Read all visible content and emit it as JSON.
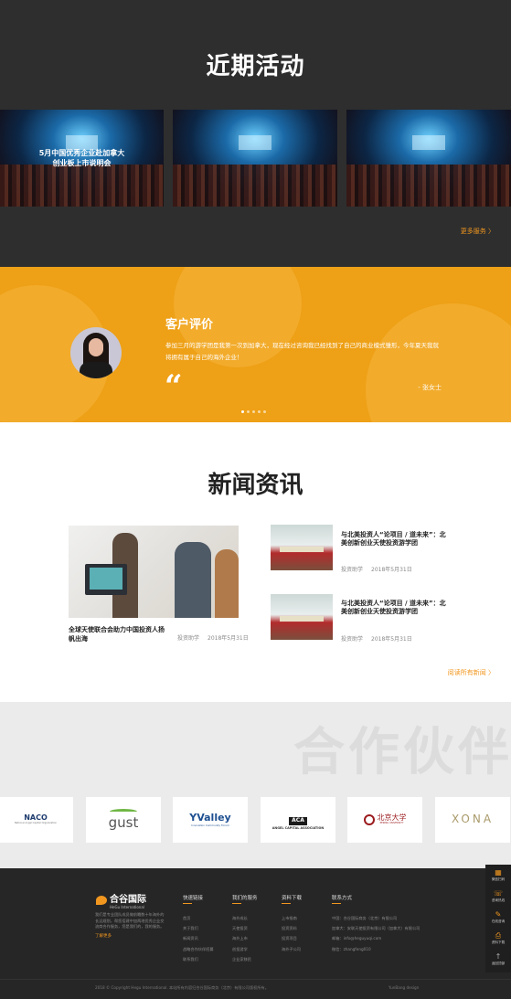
{
  "events": {
    "title": "近期活动",
    "cards": [
      {
        "caption_line1": "5月中国优秀企业赴加拿大",
        "caption_line2": "创业板上市说明会"
      },
      {
        "caption_line1": "",
        "caption_line2": ""
      },
      {
        "caption_line1": "",
        "caption_line2": ""
      }
    ],
    "more_label": "更多服务 〉"
  },
  "review": {
    "title": "客户评价",
    "text": "参加三月的游学团是我第一次到加拿大，现在经过咨询我已经找到了自己的商业模式雏形，今年夏天我就将拥有属于自己的海外企业！",
    "quote_mark": "“",
    "author": "- 张女士",
    "dots": 5,
    "active_dot": 0
  },
  "news": {
    "title": "新闻资讯",
    "main": {
      "title": "全球天使联合会助力中国投资人扬帆出海",
      "category": "投资助学",
      "date": "2018年5月31日"
    },
    "items": [
      {
        "title": "与北美投资人“论项目 / 道未来”：北美创新创业天使投资游学团",
        "category": "投资助学",
        "date": "2018年5月31日"
      },
      {
        "title": "与北美投资人“论项目 / 道未来”：北美创新创业天使投资游学团",
        "category": "投资助学",
        "date": "2018年5月31日"
      }
    ],
    "read_all_label": "阅读所有新闻 〉"
  },
  "partners": {
    "bg_title": "合作伙伴",
    "logos": [
      {
        "name": "NACO",
        "sub": "National Angel Capital Organization"
      },
      {
        "name": "gust",
        "sub": ""
      },
      {
        "name": "YValley",
        "sub": "Innovation Community Forum"
      },
      {
        "name": "ACA",
        "sub": "ANGEL CAPITAL ASSOCIATION"
      },
      {
        "name": "北京大学",
        "sub": "PEKING UNIVERSITY"
      },
      {
        "name": "XONA",
        "sub": ""
      }
    ]
  },
  "footer": {
    "logo_text": "合谷国际",
    "logo_sub": "HeGu International",
    "description": "我们是专业团队成员做前瞻数十年海外的长远规划，帮您搭建中加两地优秀企业交流商合作服务，您是我们的，我的服务。",
    "more_label": "了解更多",
    "columns": [
      {
        "title": "快速链接",
        "items": [
          "首页",
          "关于我们",
          "新闻资讯",
          "战略合作伙伴招募",
          "联系我们"
        ]
      },
      {
        "title": "我们的服务",
        "items": [
          "海外成长",
          "天使投资",
          "海外上市",
          "创投游学",
          "企业家移民"
        ]
      },
      {
        "title": "资料下载",
        "items": [
          "上市指南",
          "投资资料",
          "投资项目",
          "海外子公司"
        ]
      },
      {
        "title": "联系方式",
        "items": [
          "中国：合谷国际商务（北京）有限公司",
          "加拿大：安联天使投资有限公司（加拿大）有限公司",
          "邮箱：info@heguyuqi.com",
          "微信：zhangfeng010"
        ]
      }
    ],
    "copyright": "2018 © Copyright Hegu International. 本站所有内容归合谷国际商务（北京）有限公司版权所有。",
    "credit": "YunBang design"
  },
  "side_bar": [
    {
      "icon": "▦",
      "label": "微信扫码"
    },
    {
      "icon": "☏",
      "label": "咨询热线"
    },
    {
      "icon": "✎",
      "label": "在线咨询"
    },
    {
      "icon": "⎙",
      "label": "资料下载"
    },
    {
      "icon": "↑",
      "label": "返回顶部"
    }
  ],
  "colors": {
    "accent": "#f1971f",
    "review_bg": "#eea016",
    "dark_bg": "#2e2e2e",
    "footer_bg": "#262626"
  }
}
